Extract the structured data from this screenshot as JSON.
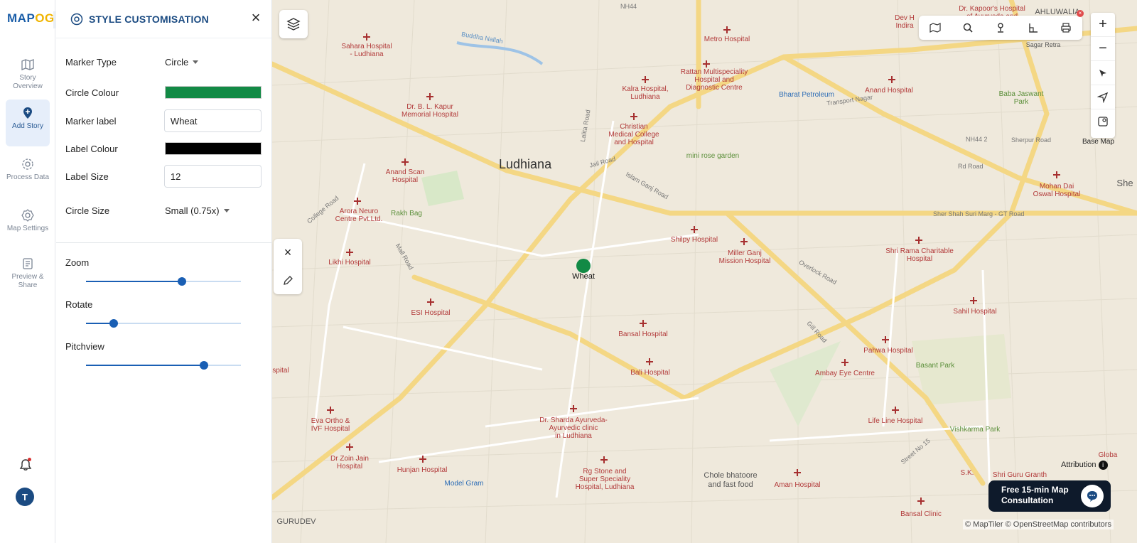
{
  "app": {
    "logo_main": "MAP",
    "logo_accent": "OG"
  },
  "rail": {
    "items": [
      {
        "label": "Story Overview"
      },
      {
        "label": "Add Story"
      },
      {
        "label": "Process Data"
      },
      {
        "label": "Map Settings"
      },
      {
        "label": "Preview & Share"
      }
    ],
    "avatar_initial": "T"
  },
  "panel": {
    "title": "STYLE CUSTOMISATION",
    "marker_type_label": "Marker Type",
    "marker_type_value": "Circle",
    "circle_colour_label": "Circle Colour",
    "circle_colour": "#128a45",
    "marker_label_label": "Marker label",
    "marker_label_value": "Wheat",
    "label_colour_label": "Label Colour",
    "label_colour": "#000000",
    "label_size_label": "Label Size",
    "label_size_value": "12",
    "circle_size_label": "Circle Size",
    "circle_size_value": "Small (0.75x)",
    "sliders": [
      {
        "label": "Zoom",
        "value": 0.62
      },
      {
        "label": "Rotate",
        "value": 0.18
      },
      {
        "label": "Pitchview",
        "value": 0.76
      }
    ]
  },
  "map": {
    "city": "Ludhiana",
    "marker_label": "Wheat",
    "base_map_label": "Base Map",
    "attribution_label": "Attribution",
    "copyright": "© MapTiler © OpenStreetMap contributors",
    "consult_line1": "Free 15-min Map",
    "consult_line2": "Consultation",
    "places": [
      {
        "name": "Sahara Hospital - Ludhiana",
        "l1": "Sahara Hospital",
        "l2": "- Ludhiana"
      },
      {
        "name": "Dr. B. L. Kapur Memorial Hospital",
        "l1": "Dr. B. L. Kapur",
        "l2": "Memorial Hospital"
      },
      {
        "name": "Metro Hospital",
        "l1": "Metro Hospital",
        "l2": ""
      },
      {
        "name": "Rattan Multispeciality",
        "l1": "Rattan Multispeciality",
        "l2": "Hospital and"
      },
      {
        "name": "Diagnostic Centre",
        "l1": "Diagnostic Centre",
        "l2": ""
      },
      {
        "name": "Kalra Hospital",
        "l1": "Kalra Hospital,",
        "l2": "Ludhiana"
      },
      {
        "name": "Christian Medical College",
        "l1": "Christian",
        "l2": "Medical College"
      },
      {
        "name": "and Hospital",
        "l1": "and Hospital",
        "l2": ""
      },
      {
        "name": "Bharat Petroleum",
        "l1": "Bharat Petroleum",
        "l2": ""
      },
      {
        "name": "Anand Hospital",
        "l1": "Anand Hospital",
        "l2": ""
      },
      {
        "name": "Baba Jaswant Park",
        "l1": "Baba Jaswant",
        "l2": "Park"
      },
      {
        "name": "Anand Scan Hospital",
        "l1": "Anand Scan",
        "l2": "Hospital"
      },
      {
        "name": "mini rose garden",
        "l1": "mini rose garden",
        "l2": ""
      },
      {
        "name": "Mohan Dai Oswal Hospital",
        "l1": "Mohan Dai",
        "l2": "Oswal Hospital"
      },
      {
        "name": "Arora Neuro Centre Pvt.Ltd.",
        "l1": "Arora Neuro",
        "l2": "Centre Pvt.Ltd."
      },
      {
        "name": "Rakh Bag",
        "l1": "Rakh Bag",
        "l2": ""
      },
      {
        "name": "Shilpy Hospital",
        "l1": "Shilpy Hospital",
        "l2": ""
      },
      {
        "name": "Miller Ganj Mission Hospital",
        "l1": "Miller Ganj",
        "l2": "Mission Hospital"
      },
      {
        "name": "Shri Rama Charitable Hospital",
        "l1": "Shri Rama Charitable",
        "l2": "Hospital"
      },
      {
        "name": "Likhi Hospital",
        "l1": "Likhi Hospital",
        "l2": ""
      },
      {
        "name": "ESI Hospital",
        "l1": "ESI Hospital",
        "l2": ""
      },
      {
        "name": "Sahil Hospital",
        "l1": "Sahil Hospital",
        "l2": ""
      },
      {
        "name": "Bansal Hospital",
        "l1": "Bansal Hospital",
        "l2": ""
      },
      {
        "name": "Pahwa Hospital",
        "l1": "Pahwa Hospital",
        "l2": ""
      },
      {
        "name": "Basant Park",
        "l1": "Basant Park",
        "l2": ""
      },
      {
        "name": "Bali Hospital",
        "l1": "Bali Hospital",
        "l2": ""
      },
      {
        "name": "Ambay Eye Centre",
        "l1": "Ambay Eye Centre",
        "l2": ""
      },
      {
        "name": "Eva Ortho & IVF Hospital",
        "l1": "Eva Ortho &",
        "l2": "IVF Hospital"
      },
      {
        "name": "Dr. Sharda Ayurveda",
        "l1": "Dr. Sharda Ayurveda-",
        "l2": "Ayurvedic clinic"
      },
      {
        "name": "in Ludhiana",
        "l1": "in Ludhiana",
        "l2": ""
      },
      {
        "name": "Life Line Hospital",
        "l1": "Life Line Hospital",
        "l2": ""
      },
      {
        "name": "Vishkarma Park",
        "l1": "Vishkarma Park",
        "l2": ""
      },
      {
        "name": "Dr Zoin Jain Hospital",
        "l1": "Dr Zoin Jain",
        "l2": "Hospital"
      },
      {
        "name": "Hunjan Hospital",
        "l1": "Hunjan Hospital",
        "l2": ""
      },
      {
        "name": "Model Gram",
        "l1": "Model Gram",
        "l2": ""
      },
      {
        "name": "Rg Stone",
        "l1": "Rg Stone and",
        "l2": "Super Speciality"
      },
      {
        "name": "Hospital, Ludhiana",
        "l1": "Hospital, Ludhiana",
        "l2": ""
      },
      {
        "name": "Chole bhatoore and fast food",
        "l1": "Chole bhatoore",
        "l2": "and fast food"
      },
      {
        "name": "Aman Hospital",
        "l1": "Aman Hospital",
        "l2": ""
      },
      {
        "name": "Shri Guru Granth",
        "l1": "Shri Guru Granth",
        "l2": ""
      },
      {
        "name": "Bansal Clinic",
        "l1": "Bansal Clinic",
        "l2": ""
      },
      {
        "name": "Dev H Indira",
        "l1": "Dev H",
        "l2": "Indira"
      },
      {
        "name": "Dr. Kapoor's Hospital of Ayurveda and",
        "l1": "Dr. Kapoor's Hospital",
        "l2": "of Ayurveda and"
      },
      {
        "name": "AHLUWALIA",
        "l1": "AHLUWALIA",
        "l2": ""
      },
      {
        "name": "Sagar Retra",
        "l1": "Sagar Retra",
        "l2": ""
      },
      {
        "name": "Globa",
        "l1": "Globa",
        "l2": ""
      },
      {
        "name": "S.K.",
        "l1": "S.K.",
        "l2": ""
      },
      {
        "name": "She",
        "l1": "She",
        "l2": ""
      },
      {
        "name": "spital",
        "l1": "spital",
        "l2": ""
      },
      {
        "name": "GURUDEV",
        "l1": "GURUDEV",
        "l2": ""
      }
    ],
    "roads": [
      {
        "name": "NH44"
      },
      {
        "name": "Buddha Nallah"
      },
      {
        "name": "Transport Nagar"
      },
      {
        "name": "Jail Road"
      },
      {
        "name": "Islam Ganj Road"
      },
      {
        "name": "College Road"
      },
      {
        "name": "Mall Road"
      },
      {
        "name": "Sher Shah Suri Marg - GT Road"
      },
      {
        "name": "Overlock Road"
      },
      {
        "name": "Gill Road"
      },
      {
        "name": "Street No 15"
      },
      {
        "name": "Sherpur Road"
      },
      {
        "name": "NH44 2"
      },
      {
        "name": "Rd Road"
      },
      {
        "name": "Lalita Road"
      }
    ]
  }
}
